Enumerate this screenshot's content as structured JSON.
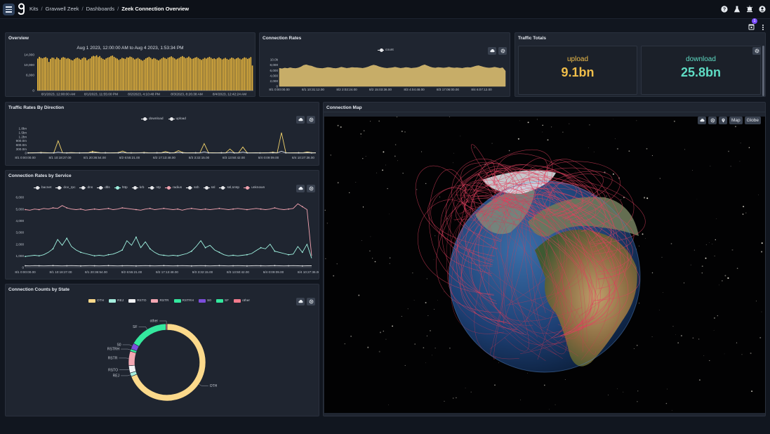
{
  "breadcrumb": {
    "items": [
      "Kits",
      "Gravwell Zeek",
      "Dashboards"
    ],
    "current": "Zeek Connection Overview"
  },
  "notifications": {
    "count": "1"
  },
  "overview": {
    "title": "Overview",
    "range": "Aug 1 2023, 12:00:00 AM to Aug 4 2023, 1:53:34 PM",
    "chart_data": {
      "type": "bar",
      "ylim": [
        0,
        14000
      ],
      "y_ticks": [
        "14,000",
        "10,000",
        "6,000",
        "0"
      ],
      "x_ticks": [
        "8/1/2023, 12:00:00 AM",
        "8/1/2023, 11:55:00 PM",
        "8/2/2023, 4:10:48 PM",
        "8/3/2023, 8:26:38 AM",
        "8/4/2023, 12:42:24 AM"
      ],
      "values": [
        12500,
        13200,
        12800,
        12600,
        12900,
        13100,
        12700,
        11200,
        12400,
        12900,
        12800,
        12300,
        13000,
        12600,
        12100,
        12800,
        13100,
        12900,
        12500,
        12700,
        12400,
        12000,
        11800,
        12300,
        12700,
        12900,
        12500,
        12100,
        12600,
        13000,
        12800,
        11900,
        12300,
        12600,
        13300,
        13600,
        13400,
        13800,
        13100,
        13500,
        12800,
        12400,
        12100,
        12600,
        12900,
        13100,
        13500,
        13700,
        13200,
        12800,
        12500,
        12000,
        12300,
        12800,
        12600,
        12400,
        13000,
        12900,
        13300,
        13100,
        12700,
        12200,
        12500,
        12800,
        12400,
        12000,
        11700,
        12100,
        12600,
        12900,
        13200,
        12800,
        12300,
        12700,
        12500,
        12100,
        11800,
        12200,
        12600,
        13000,
        12700,
        12400,
        12900,
        13100,
        13400,
        13000,
        12600,
        12200,
        12500,
        12800,
        13200,
        13500,
        13100,
        12700,
        12900,
        13300,
        12800,
        12400,
        12600,
        12900,
        13100,
        12700,
        12300,
        12000,
        12400,
        12800,
        12500,
        12900,
        13200,
        12800,
        12400,
        12600,
        12300,
        12700,
        13000,
        12600,
        12200,
        12500,
        12800,
        12400,
        12100,
        12500,
        12900,
        12700,
        12300,
        12600,
        12900,
        12500,
        12200,
        12600,
        13000,
        12800,
        12400,
        12700,
        13100,
        9800
      ]
    }
  },
  "connection_rates": {
    "title": "Connection Rates",
    "legend": "count",
    "color": "#c7ad68",
    "chart_data": {
      "type": "area",
      "series_name": "count",
      "ylim": [
        0,
        10000
      ],
      "y_ticks": [
        "10.0k",
        "8,000",
        "6,000",
        "4,000",
        "2,000",
        "0"
      ],
      "x_ticks": [
        "8/1 0:00:00.00",
        "8/1 10:31:12.00",
        "8/2 2:02:24.00",
        "8/2 15:03:36.00",
        "8/3 4:04:48.00",
        "8/3 17:06:00.00",
        "8/4 6:07:12.00"
      ],
      "values": [
        6800,
        6600,
        6900,
        6700,
        7000,
        6800,
        6700,
        6900,
        7300,
        7900,
        8100,
        7800,
        7600,
        7200,
        6900,
        6800,
        6700,
        6900,
        7100,
        7000,
        6800,
        6700,
        6900,
        7200,
        7000,
        6800,
        6900,
        7100,
        7000,
        7000,
        6900,
        6800,
        7000,
        7300,
        7700,
        8000,
        7800,
        7400,
        7100,
        6900,
        6800,
        6900,
        7000,
        7200,
        7000,
        6800,
        6900,
        7100,
        7000,
        6800,
        6900,
        7000,
        7300,
        7800,
        8100,
        7700,
        7300,
        7000,
        6900,
        7100,
        7000,
        6900,
        7000,
        7200,
        7000,
        6900,
        7000,
        6900,
        6800,
        7000,
        7100,
        7000,
        7300,
        7600,
        7800,
        7500,
        7200,
        7000,
        6900,
        7000,
        7200,
        7000,
        6800,
        7000,
        5800
      ]
    }
  },
  "traffic_totals": {
    "title": "Traffic Totals",
    "upload_label": "upload",
    "upload_value": "9.1bn",
    "download_label": "download",
    "download_value": "25.8bn",
    "upload_color": "#f0be4a",
    "download_color": "#5fdcc4"
  },
  "traffic_direction": {
    "title": "Traffic Rates By Direction",
    "legend": [
      "download",
      "upload"
    ],
    "chart_data": {
      "type": "line",
      "y_ticks": [
        "1.8bn",
        "1.5bn",
        "1.2bn",
        "900.0m",
        "600.0m",
        "300.0m",
        "0"
      ],
      "x_ticks": [
        "8/1 0:00:00.00",
        "8/1 10:18:27.00",
        "8/1 20:36:54.00",
        "8/2 6:55:21.00",
        "8/2 17:13:48.00",
        "8/3 3:32:15.00",
        "8/3 13:50:42.00",
        "8/4 0:09:09.00",
        "8/4 10:27:36.00"
      ],
      "series": [
        {
          "name": "download",
          "color": "#f2d36b",
          "values": [
            20,
            25,
            30,
            40,
            35,
            20,
            25,
            900,
            30,
            20,
            40,
            25,
            20,
            30,
            25,
            120,
            60,
            20,
            30,
            20,
            25,
            30,
            150,
            20,
            25,
            20,
            30,
            40,
            25,
            20,
            30,
            25,
            120,
            20,
            25,
            180,
            40,
            20,
            25,
            30,
            20,
            700,
            30,
            25,
            20,
            30,
            20,
            300,
            20,
            25,
            450,
            25,
            20,
            30,
            20,
            25,
            30,
            60,
            20,
            1500,
            30,
            20,
            25,
            30,
            20,
            90,
            25,
            30
          ]
        },
        {
          "name": "upload",
          "color": "#d8dde4",
          "values": [
            10,
            12,
            15,
            18,
            12,
            10,
            12,
            60,
            15,
            10,
            14,
            12,
            10,
            15,
            12,
            30,
            20,
            10,
            14,
            10,
            12,
            15,
            40,
            10,
            12,
            10,
            15,
            18,
            12,
            10,
            15,
            12,
            35,
            10,
            12,
            50,
            18,
            10,
            12,
            15,
            10,
            90,
            15,
            12,
            10,
            14,
            10,
            60,
            10,
            12,
            70,
            12,
            10,
            15,
            10,
            12,
            15,
            22,
            10,
            140,
            15,
            10,
            12,
            14,
            10,
            25,
            12,
            15
          ]
        }
      ]
    }
  },
  "rates_by_service": {
    "title": "Connection Rates by Service",
    "legend": [
      {
        "name": "bacnet",
        "color": "#e8e9ec"
      },
      {
        "name": "dce_rpc",
        "color": "#e8e9ec"
      },
      {
        "name": "dns",
        "color": "#e8e9ec"
      },
      {
        "name": "dtls",
        "color": "#e8e9ec"
      },
      {
        "name": "http",
        "color": "#9ff2e0"
      },
      {
        "name": "krb",
        "color": "#e8e9ec"
      },
      {
        "name": "ntp",
        "color": "#e8e9ec"
      },
      {
        "name": "radius",
        "color": "#f3a3b0"
      },
      {
        "name": "ssh",
        "color": "#e8e9ec"
      },
      {
        "name": "ssl",
        "color": "#e8e9ec"
      },
      {
        "name": "ssl,smtp",
        "color": "#e8e9ec"
      },
      {
        "name": "unknown",
        "color": "#f3a3b0"
      }
    ],
    "chart_data": {
      "type": "line",
      "ylim": [
        0,
        6000
      ],
      "y_ticks": [
        "6,000",
        "5,000",
        "4,000",
        "3,000",
        "2,000",
        "1,000",
        "0"
      ],
      "x_ticks": [
        "8/1 0:00:00.00",
        "8/1 10:18:27.00",
        "8/1 20:36:54.00",
        "8/2 6:55:21.00",
        "8/2 17:13:48.00",
        "8/3 3:32:15.00",
        "8/3 13:50:42.00",
        "8/4 0:09:09.00",
        "8/4 10:27:36.00"
      ],
      "series": [
        {
          "name": "unknown",
          "color": "#f3a3b0",
          "values": [
            4950,
            4900,
            5000,
            4950,
            5050,
            5000,
            5100,
            5050,
            5300,
            5100,
            5000,
            4950,
            5000,
            4900,
            4950,
            5000,
            4950,
            5000,
            5050,
            4950,
            5000,
            5100,
            5050,
            5000,
            4950,
            4900,
            5000,
            5050,
            4950,
            5000,
            5050,
            5000,
            4950,
            5000,
            4900,
            5000,
            5050,
            5000,
            4950,
            5000,
            4950,
            5000,
            5050,
            5000,
            4950,
            5000,
            5050,
            5000,
            4950,
            5000,
            5050,
            5000,
            4950,
            5000,
            5100,
            5000,
            4950,
            5000,
            5050,
            5450,
            5200,
            4950,
            1000
          ]
        },
        {
          "name": "http",
          "color": "#9ff2e0",
          "values": [
            950,
            1000,
            1050,
            1000,
            1100,
            1300,
            1600,
            2400,
            1900,
            2500,
            1800,
            1500,
            1300,
            1200,
            1100,
            1000,
            1050,
            1000,
            1100,
            1150,
            1300,
            1500,
            2300,
            1900,
            2600,
            1700,
            2200,
            1600,
            1300,
            1100,
            1050,
            1000,
            1050,
            1000,
            1100,
            1200,
            1400,
            1800,
            2300,
            1700,
            1900,
            1500,
            1300,
            1100,
            1000,
            1050,
            1000,
            1050,
            1100,
            1200,
            1450,
            1700,
            1600,
            2000,
            1400,
            1300,
            1200,
            1100,
            1150,
            1800,
            1300,
            2000,
            800
          ]
        },
        {
          "name": "other",
          "color": "#e8e9ec",
          "values": [
            150,
            140,
            160,
            150,
            140,
            150,
            160,
            150,
            140,
            150,
            160,
            150,
            140,
            150,
            160,
            150,
            140,
            150,
            160,
            150,
            140,
            150,
            160,
            150,
            140,
            150,
            160,
            150,
            140,
            150,
            160,
            150,
            140,
            150,
            160,
            150,
            140,
            150,
            160,
            150,
            140,
            150,
            160,
            150,
            140,
            150,
            160,
            150,
            140,
            150,
            160,
            150,
            140,
            150,
            160,
            150,
            140,
            150,
            160,
            150,
            140,
            150,
            150
          ]
        }
      ]
    }
  },
  "counts_by_state": {
    "title": "Connection Counts by State",
    "legend": [
      {
        "name": "OTH",
        "color": "#fbd98b"
      },
      {
        "name": "REJ",
        "color": "#a6eede"
      },
      {
        "name": "RSTO",
        "color": "#f3f4f6"
      },
      {
        "name": "RSTR",
        "color": "#f3a7b2"
      },
      {
        "name": "RSTRH",
        "color": "#34e89e"
      },
      {
        "name": "S0",
        "color": "#7c4ddb"
      },
      {
        "name": "SF",
        "color": "#34e89e"
      },
      {
        "name": "other",
        "color": "#f27a8c"
      }
    ],
    "chart_data": {
      "type": "pie",
      "labels": [
        "OTH",
        "REJ",
        "RSTO",
        "RSTR",
        "RSTRH",
        "S0",
        "SF",
        "other"
      ],
      "values": [
        68,
        1.5,
        3,
        6,
        1,
        2.5,
        16,
        0.5
      ]
    }
  },
  "connection_map": {
    "title": "Connection Map",
    "map_label": "Map",
    "globe_label": "Globe"
  }
}
